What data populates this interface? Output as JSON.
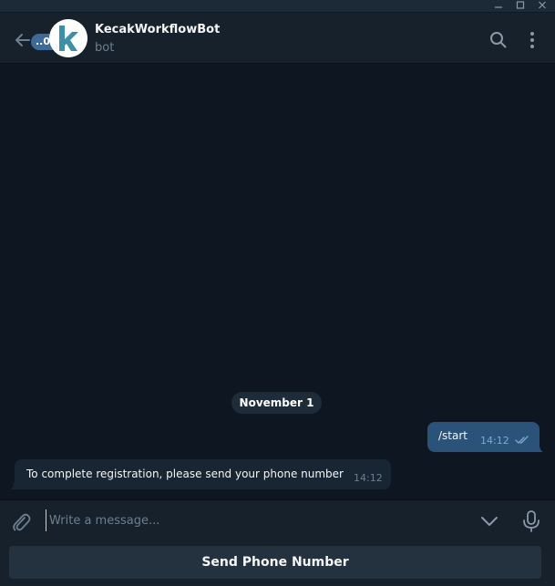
{
  "window": {
    "minimize_icon": "minimize-icon",
    "maximize_icon": "maximize-icon",
    "close_icon": "close-icon"
  },
  "header": {
    "unread_count": "..01",
    "title": "KecakWorkflowBot",
    "subtitle": "bot",
    "avatar_letter": "k",
    "icons": [
      "back-arrow-icon",
      "search-icon",
      "more-vertical-icon"
    ]
  },
  "messages": {
    "date_separator": "November 1",
    "items": [
      {
        "direction": "out",
        "text": "/start",
        "time": "14:12",
        "status": "read"
      },
      {
        "direction": "in",
        "text": "To complete registration, please send your phone number",
        "time": "14:12"
      }
    ]
  },
  "composer": {
    "placeholder": "Write a message...",
    "icons": [
      "paperclip-icon",
      "chevron-down-icon",
      "microphone-icon"
    ]
  },
  "keyboard": {
    "button_label": "Send Phone Number"
  },
  "colors": {
    "background": "#0e1621",
    "header": "#17212b",
    "outgoing_bubble": "#2b5278",
    "incoming_bubble": "#182533",
    "accent": "#3e6a99"
  }
}
